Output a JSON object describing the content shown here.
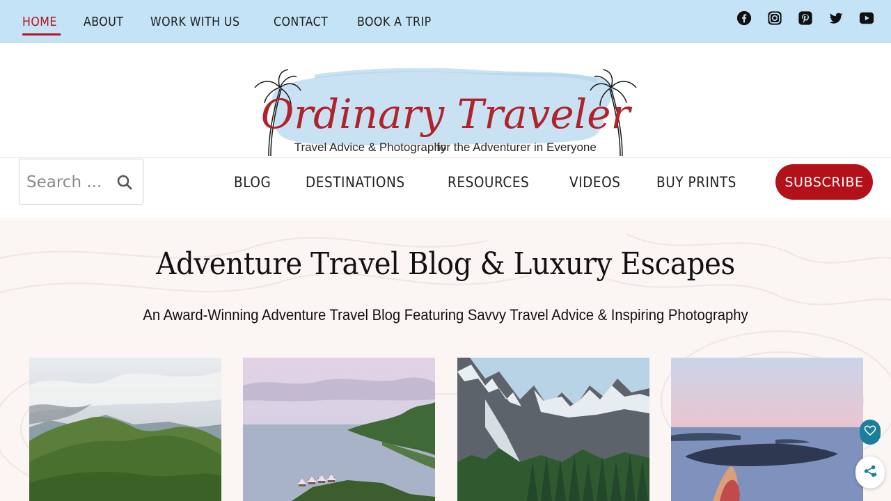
{
  "topbar": {
    "nav": [
      {
        "label": "HOME",
        "active": true
      },
      {
        "label": "ABOUT"
      },
      {
        "label": "WORK WITH US"
      },
      {
        "label": "CONTACT"
      },
      {
        "label": "BOOK A TRIP"
      }
    ],
    "social": [
      "facebook-icon",
      "instagram-icon",
      "pinterest-icon",
      "twitter-icon",
      "youtube-icon"
    ],
    "background": "#c4e3f6",
    "active_color": "#b3141d"
  },
  "logo": {
    "title": "Ordinary Traveler",
    "tagline_left": "Travel Advice & Photography",
    "tagline_right": "for the Adventurer in Everyone"
  },
  "search": {
    "placeholder": "Search ..."
  },
  "mainnav": [
    {
      "label": "BLOG"
    },
    {
      "label": "DESTINATIONS"
    },
    {
      "label": "RESOURCES"
    },
    {
      "label": "VIDEOS"
    },
    {
      "label": "BUY PRINTS"
    }
  ],
  "subscribe": {
    "label": "SUBSCRIBE",
    "color": "#b3111a"
  },
  "hero": {
    "title": "Adventure Travel Blog & Luxury Escapes",
    "subtitle": "An Award-Winning Adventure Travel Blog Featuring Savvy Travel Advice & Inspiring Photography"
  },
  "cards": [
    "green-mountains-photo",
    "overwater-bungalows-photo",
    "snowy-peaks-lake-photo",
    "santorini-sunset-photo"
  ],
  "floating": [
    "heart-icon",
    "share-icon"
  ]
}
